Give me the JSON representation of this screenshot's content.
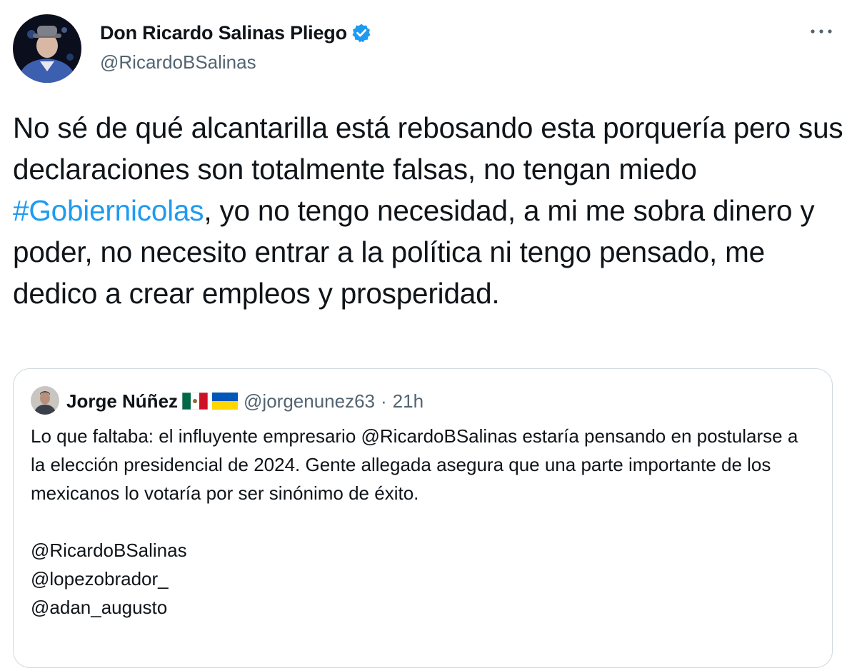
{
  "author": {
    "display_name": "Don Ricardo Salinas Pliego",
    "handle": "@RicardoBSalinas",
    "verified_icon": "verified-badge-icon",
    "avatar_icon": "profile-photo-avatar"
  },
  "more_icon": "more-options-icon",
  "tweet": {
    "text_before": "No sé de qué alcantarilla está rebosando esta porquería pero sus declaraciones son totalmente falsas, no tengan miedo ",
    "hashtag": "#Gobiernicolas",
    "text_after": ", yo no tengo necesidad, a mi me sobra dinero y poder, no necesito entrar a la política ni tengo pensado, me dedico a crear empleos y prosperidad."
  },
  "quoted_tweet": {
    "display_name": "Jorge Núñez",
    "flags": [
      "mexico-flag-icon",
      "ukraine-flag-icon"
    ],
    "handle": "@jorgenunez63",
    "separator": "·",
    "time": "21h",
    "text": "Lo que faltaba: el influyente empresario @RicardoBSalinas estaría pensando en postularse a la elección presidencial de 2024. Gente allegada asegura que una parte importante de los mexicanos lo votaría por ser sinónimo de éxito.",
    "mentions": [
      "@RicardoBSalinas",
      "@lopezobrador_",
      "@adan_augusto"
    ]
  },
  "colors": {
    "text": "#0f1419",
    "secondary": "#536471",
    "link": "#1d9bf0",
    "border": "#cfd9de"
  }
}
